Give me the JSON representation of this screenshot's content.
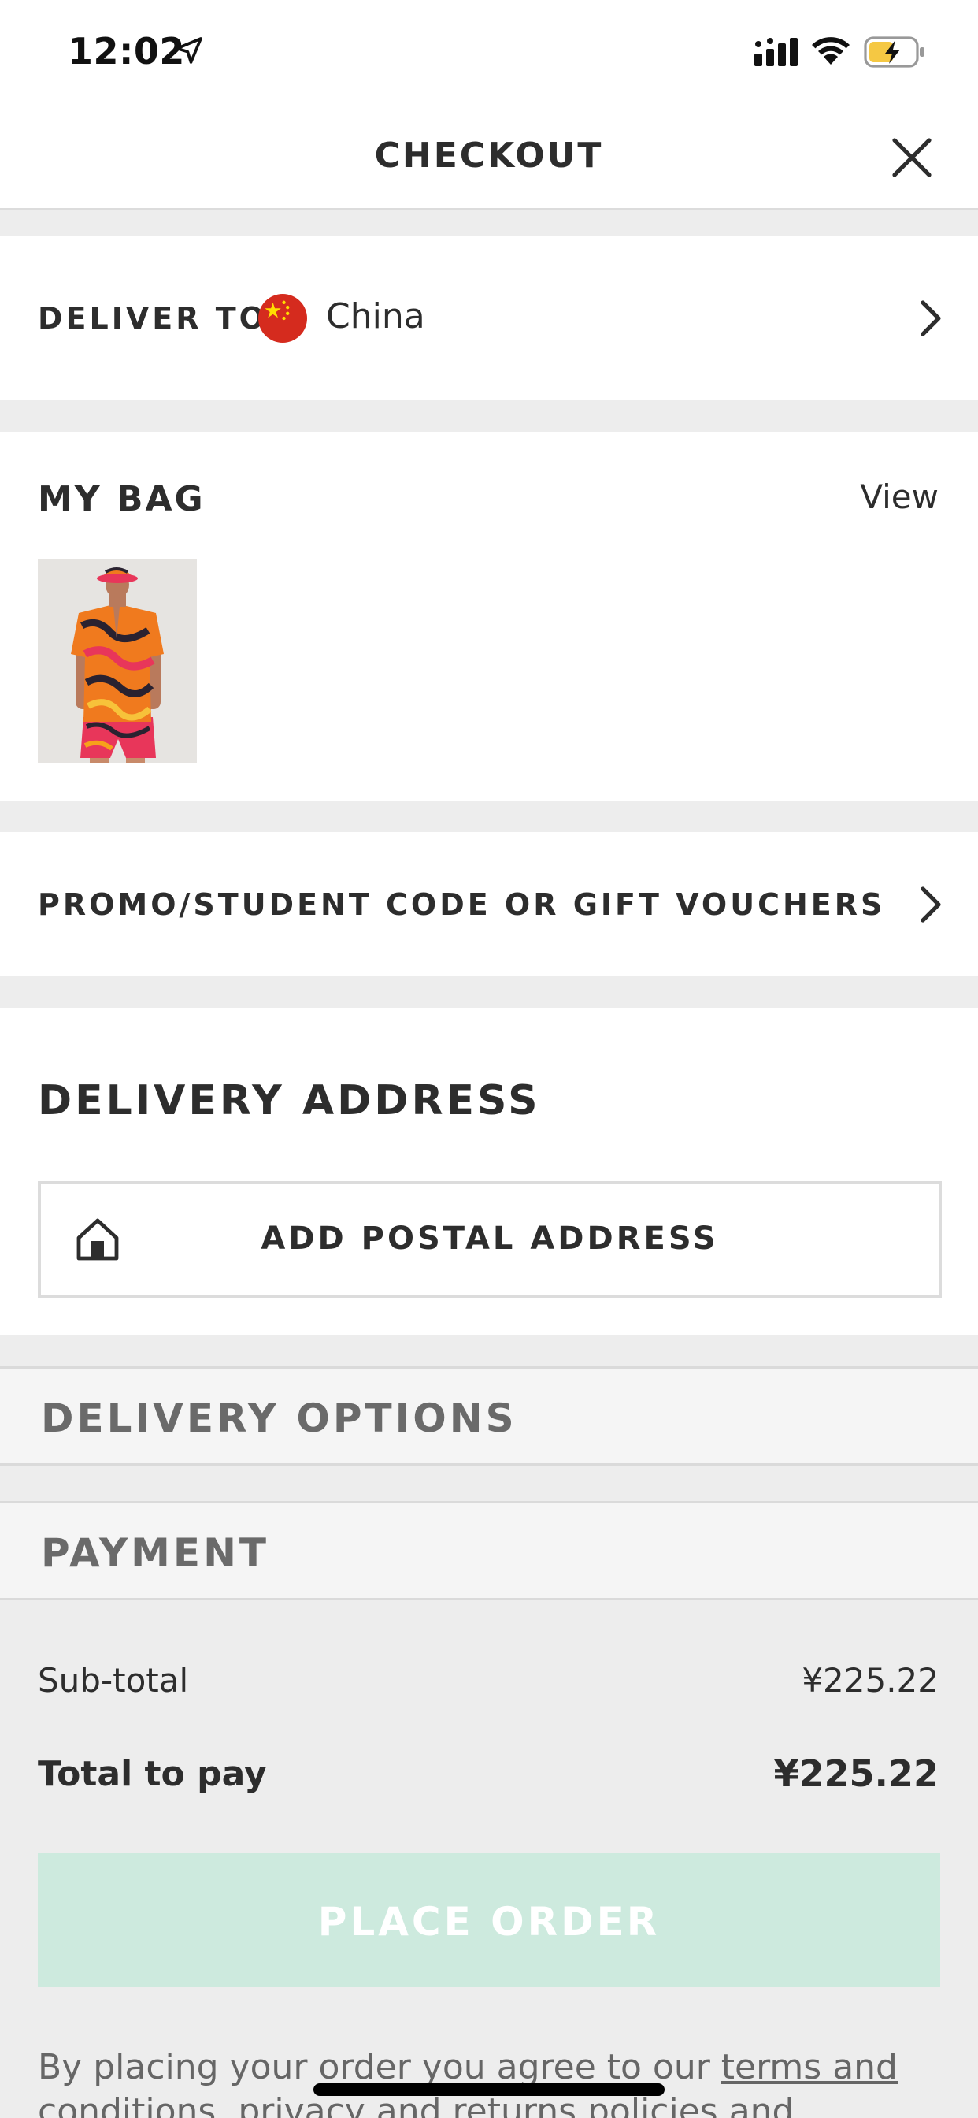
{
  "status_bar": {
    "time": "12:02"
  },
  "header": {
    "title": "CHECKOUT"
  },
  "deliver_to": {
    "label": "DELIVER TO:",
    "country": "China"
  },
  "my_bag": {
    "title": "MY BAG",
    "view_label": "View"
  },
  "promo": {
    "label": "PROMO/STUDENT CODE OR GIFT VOUCHERS"
  },
  "delivery_address": {
    "title": "DELIVERY ADDRESS",
    "add_button_label": "ADD POSTAL ADDRESS"
  },
  "steps": {
    "delivery_options": "DELIVERY OPTIONS",
    "payment": "PAYMENT"
  },
  "totals": {
    "subtotal_label": "Sub-total",
    "subtotal_value": "¥225.22",
    "total_label": "Total to pay",
    "total_value": "¥225.22"
  },
  "place_order": {
    "label": "PLACE ORDER"
  },
  "legal": {
    "prefix": "By placing your order you agree to our ",
    "terms_link": "terms and",
    "suffix": " conditions, privacy and returns policies and consent to"
  },
  "colors": {
    "place_order_bg": "#cdeade",
    "page_bg": "#ededed",
    "step_title": "#6a6a6a"
  },
  "icons": {
    "close": "close-icon",
    "chevron": "chevron-right-icon",
    "house": "house-icon",
    "flag": "china-flag-icon"
  }
}
